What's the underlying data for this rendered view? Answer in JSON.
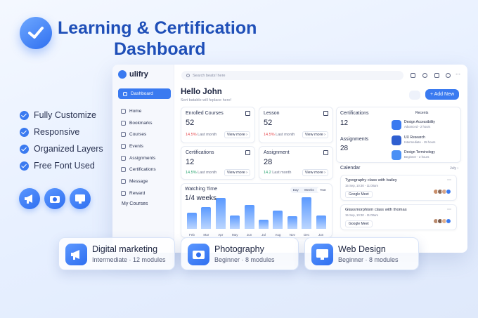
{
  "hero": {
    "title_line1": "Learning & Certification",
    "title_line2": "Dashboard"
  },
  "features": [
    "Fully Customize",
    "Responsive",
    "Organized Layers",
    "Free Font Used"
  ],
  "app": {
    "brand": "ulifry",
    "search_placeholder": "Search beats! here",
    "sidebar_active": "Dashboard",
    "sidebar": [
      "Home",
      "Bookmarks",
      "Courses",
      "Events",
      "Assignments",
      "Certifications",
      "Message",
      "Reward"
    ],
    "sidebar_section": "My Courses",
    "greeting": "Hello John",
    "subtitle": "Sort batable will feplace here!",
    "add_new": "+ Add New",
    "stats": [
      {
        "label": "Enrolled Courses",
        "value": "52",
        "change": "14.5%",
        "trend": "down",
        "period": "Last month",
        "link": "View more ›"
      },
      {
        "label": "Lesson",
        "value": "52",
        "change": "14.5%",
        "trend": "down",
        "period": "Last month",
        "link": "View more ›"
      },
      {
        "label": "Certifications",
        "value": "12",
        "change": "14.5%",
        "trend": "up",
        "period": "Last month",
        "link": "View more ›"
      },
      {
        "label": "Assignment",
        "value": "28",
        "change": "14.2",
        "trend": "up",
        "period": "Last month",
        "link": "View more ›"
      }
    ],
    "watching": {
      "title": "Watching Time",
      "value": "1/4 weeks",
      "tabs": [
        "Day",
        "Weeks",
        "Year"
      ],
      "active_tab": "Year"
    },
    "summary": {
      "cert_label": "Certifications",
      "cert_value": "12",
      "assign_label": "Assignments",
      "assign_value": "28",
      "recents_label": "Recents",
      "recents": [
        {
          "name": "Design Accessibility",
          "detail": "Advanced - 2 hours",
          "color": "#3a7af0"
        },
        {
          "name": "UX Research",
          "detail": "Intermediate - 15 hours",
          "color": "#2f5fd0"
        },
        {
          "name": "Design Terminology",
          "detail": "Beginner - 2 hours",
          "color": "#4a90f5"
        }
      ]
    },
    "calendar": {
      "title": "Calendar",
      "month": "July ›",
      "events": [
        {
          "name": "Typography class with bailey",
          "time": "15 Sep, 10:30 - 11:00am",
          "meet": "Google Meet"
        },
        {
          "name": "Glassmorphism class with thomas",
          "time": "15 Sep, 10:30 - 11:00am",
          "meet": "Google Meet"
        }
      ]
    }
  },
  "chart_data": {
    "type": "bar",
    "categories": [
      "Feb",
      "Mar",
      "Apr",
      "May",
      "Jun",
      "Jul",
      "Aug",
      "Nov",
      "Dec",
      "Jun"
    ],
    "values": [
      35,
      48,
      68,
      30,
      52,
      20,
      40,
      28,
      70,
      30
    ],
    "ylim": [
      0,
      100
    ],
    "title": "Watching Time"
  },
  "course_cards": [
    {
      "title": "Digital marketing",
      "detail": "Intermediate · 12 modules"
    },
    {
      "title": "Photography",
      "detail": "Beginner · 8 modules"
    },
    {
      "title": "Web Design",
      "detail": "Beginner · 8 modules"
    }
  ],
  "colors": {
    "accent": "#3a7af0",
    "title": "#1f4fb8"
  }
}
